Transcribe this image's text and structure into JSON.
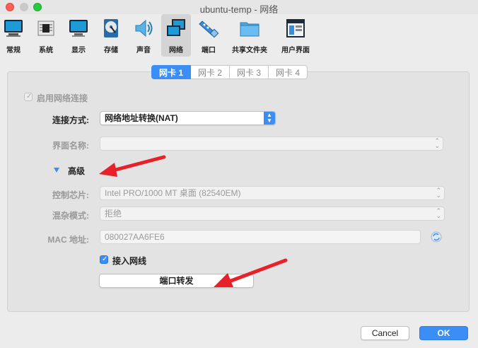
{
  "window": {
    "title": "ubuntu-temp - 网络"
  },
  "toolbar": [
    {
      "label": "常规",
      "icon": "monitor-general-icon"
    },
    {
      "label": "系统",
      "icon": "chip-icon"
    },
    {
      "label": "显示",
      "icon": "display-icon"
    },
    {
      "label": "存储",
      "icon": "disk-icon"
    },
    {
      "label": "声音",
      "icon": "speaker-icon"
    },
    {
      "label": "网络",
      "icon": "network-icon",
      "active": true
    },
    {
      "label": "端口",
      "icon": "port-icon"
    },
    {
      "label": "共享文件夹",
      "icon": "folder-icon"
    },
    {
      "label": "用户界面",
      "icon": "ui-window-icon"
    }
  ],
  "tabs": [
    "网卡 1",
    "网卡 2",
    "网卡 3",
    "网卡 4"
  ],
  "form": {
    "enable_network": "启用网络连接",
    "attached_to_label": "连接方式:",
    "attached_to_value": "网络地址转换(NAT)",
    "name_label": "界面名称:",
    "name_value": "",
    "advanced": "高级",
    "adapter_type_label": "控制芯片:",
    "adapter_type_value": "Intel PRO/1000 MT 桌面 (82540EM)",
    "promiscuous_label": "混杂模式:",
    "promiscuous_value": "拒绝",
    "mac_label": "MAC 地址:",
    "mac_value": "080027AA6FE6",
    "cable_connected": "接入网线",
    "port_forwarding": "端口转发"
  },
  "buttons": {
    "cancel": "Cancel",
    "ok": "OK"
  },
  "colors": {
    "accent": "#3a8ef6",
    "annotation_arrow": "#e8202a"
  }
}
